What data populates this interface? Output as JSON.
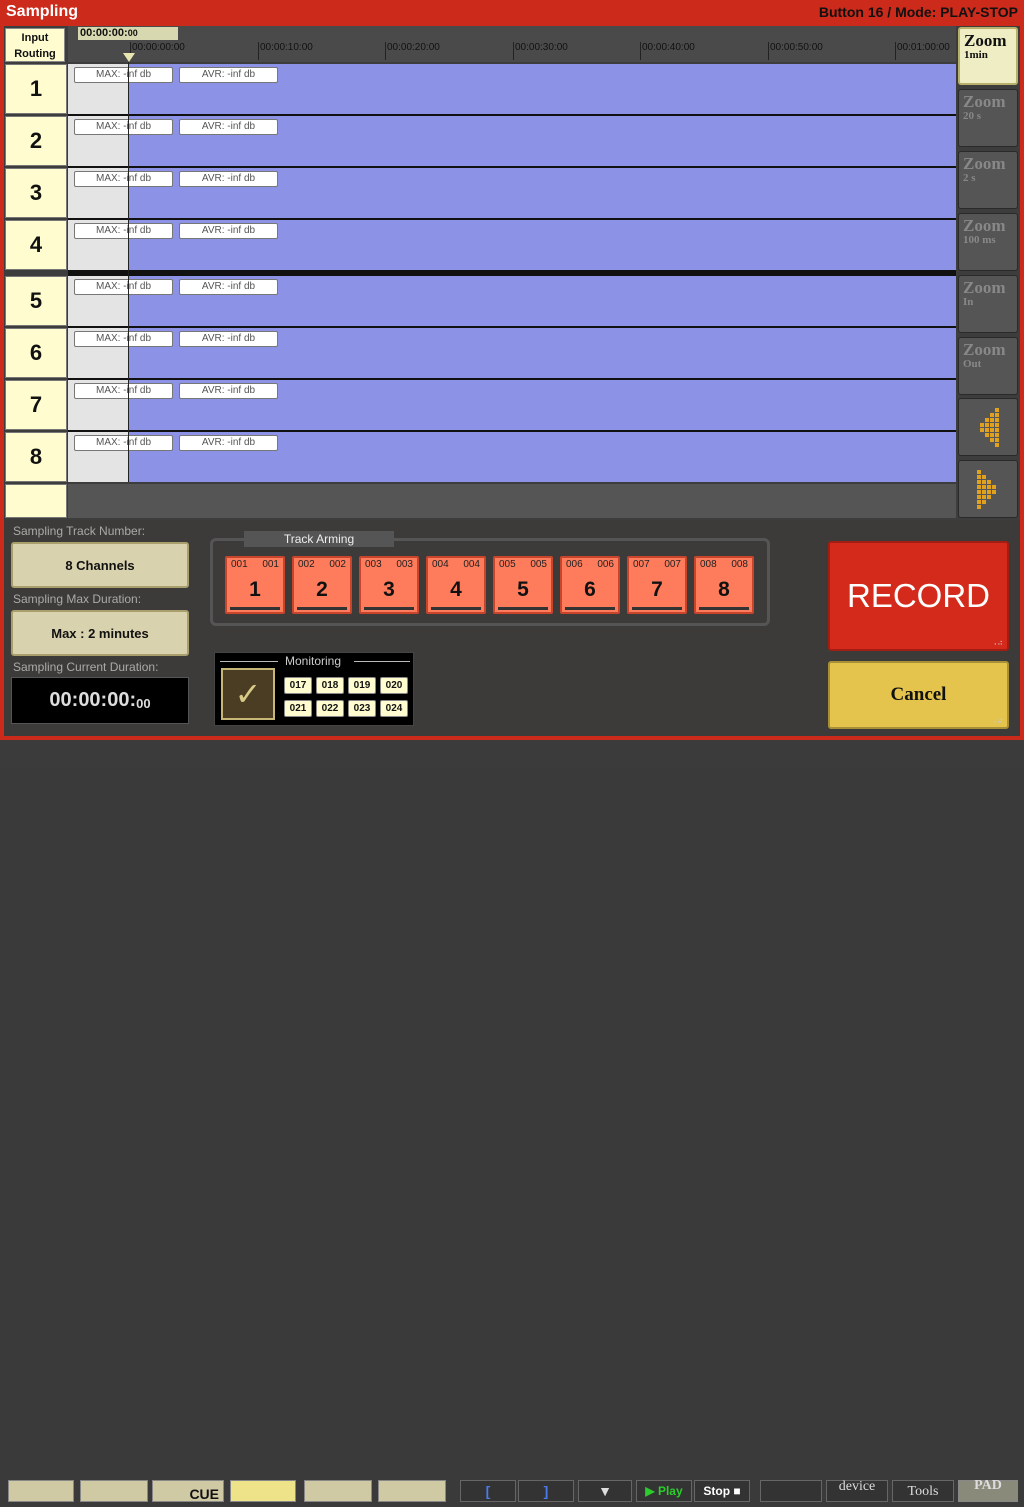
{
  "title": "Sampling",
  "mode": "Button 16 / Mode: PLAY-STOP",
  "routing": {
    "line1": "Input",
    "line2": "Routing"
  },
  "current_time": {
    "main": "00:00:00:",
    "frac": "00"
  },
  "ruler": [
    "00:00:00:00",
    "00:00:10:00",
    "00:00:20:00",
    "00:00:30:00",
    "00:00:40:00",
    "00:00:50:00",
    "00:01:00:00"
  ],
  "tracks": [
    {
      "num": "1",
      "max": "MAX: -inf db",
      "avr": "AVR: -inf db"
    },
    {
      "num": "2",
      "max": "MAX: -inf db",
      "avr": "AVR: -inf db"
    },
    {
      "num": "3",
      "max": "MAX: -inf db",
      "avr": "AVR: -inf db"
    },
    {
      "num": "4",
      "max": "MAX: -inf db",
      "avr": "AVR: -inf db"
    },
    {
      "num": "5",
      "max": "MAX: -inf db",
      "avr": "AVR: -inf db"
    },
    {
      "num": "6",
      "max": "MAX: -inf db",
      "avr": "AVR: -inf db"
    },
    {
      "num": "7",
      "max": "MAX: -inf db",
      "avr": "AVR: -inf db"
    },
    {
      "num": "8",
      "max": "MAX: -inf db",
      "avr": "AVR: -inf db"
    }
  ],
  "zoom": [
    {
      "title": "Zoom",
      "sub": "1min",
      "active": true
    },
    {
      "title": "Zoom",
      "sub": "20 s",
      "active": false
    },
    {
      "title": "Zoom",
      "sub": "2 s",
      "active": false
    },
    {
      "title": "Zoom",
      "sub": "100 ms",
      "active": false
    },
    {
      "title": "Zoom",
      "sub": "In",
      "active": false
    },
    {
      "title": "Zoom",
      "sub": "Out",
      "active": false
    }
  ],
  "scroll_icons": [
    "arrow-left-icon",
    "arrow-right-icon"
  ],
  "panel": {
    "track_number_label": "Sampling Track Number:",
    "track_number_value": "8 Channels",
    "max_duration_label": "Sampling Max Duration:",
    "max_duration_value": "Max : 2 minutes",
    "current_duration_label": "Sampling Current Duration:",
    "current_duration_main": "00:00:00:",
    "current_duration_frac": "00"
  },
  "arming": {
    "title": "Track Arming",
    "tracks": [
      {
        "a": "001",
        "b": "001",
        "n": "1"
      },
      {
        "a": "002",
        "b": "002",
        "n": "2"
      },
      {
        "a": "003",
        "b": "003",
        "n": "3"
      },
      {
        "a": "004",
        "b": "004",
        "n": "4"
      },
      {
        "a": "005",
        "b": "005",
        "n": "5"
      },
      {
        "a": "006",
        "b": "006",
        "n": "6"
      },
      {
        "a": "007",
        "b": "007",
        "n": "7"
      },
      {
        "a": "008",
        "b": "008",
        "n": "8"
      }
    ]
  },
  "monitoring": {
    "title": "Monitoring",
    "check": "✓",
    "channels": [
      "017",
      "018",
      "019",
      "020",
      "021",
      "022",
      "023",
      "024"
    ]
  },
  "record_label": "RECORD",
  "cancel_label": "Cancel",
  "background_bar": {
    "cue": "CUE",
    "play": "Play",
    "stop": "Stop",
    "device": "device",
    "tools": "Tools",
    "pad": "PAD"
  },
  "colors": {
    "frame": "#cc2a1a",
    "track": "#8c92e6",
    "arm": "#fe7c5c",
    "record": "#d32a1b",
    "cancel": "#e4c44c"
  }
}
